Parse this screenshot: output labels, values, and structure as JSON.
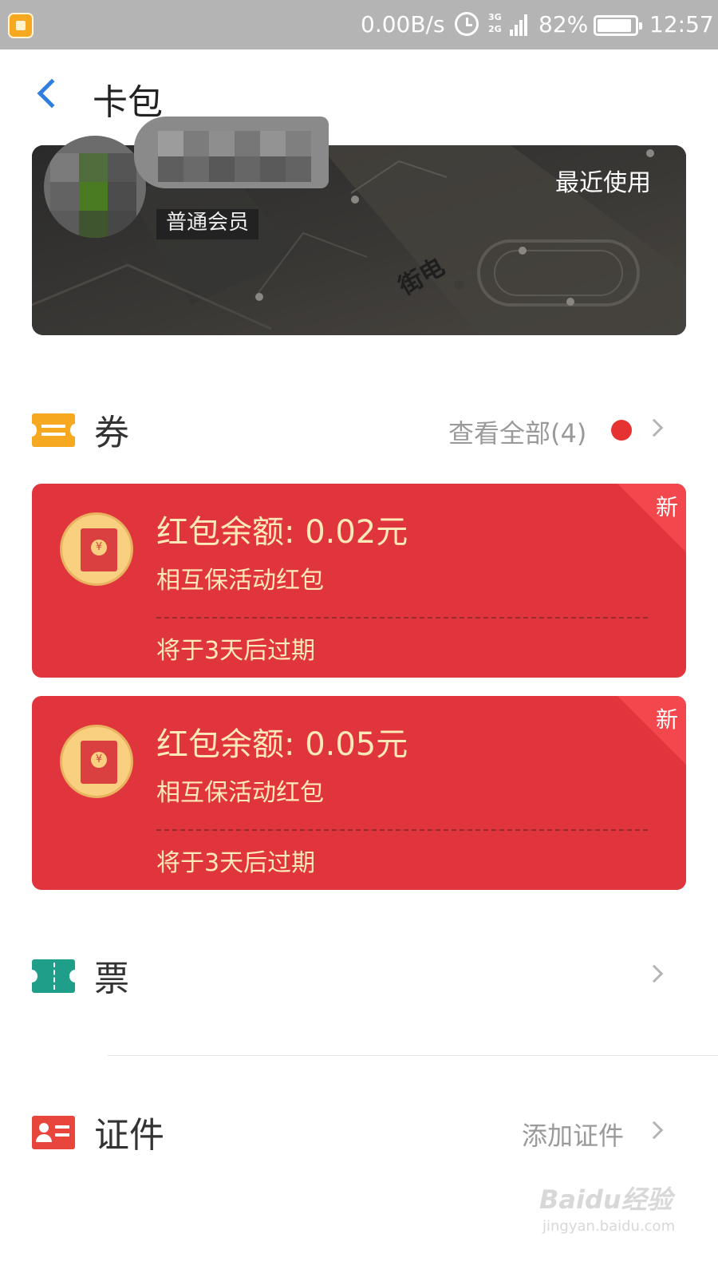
{
  "status_bar": {
    "net_speed": "0.00B/s",
    "network_labels": [
      "3G",
      "2G"
    ],
    "battery": "82%",
    "time": "12:57"
  },
  "header": {
    "title": "卡包",
    "back_icon": "chevron-left-icon"
  },
  "member_card": {
    "recent_label": "最近使用",
    "member_level": "普通会员",
    "avatar": "blurred",
    "name": "blurred"
  },
  "coupons": {
    "title": "券",
    "view_all": "查看全部(4)",
    "has_new_dot": true,
    "items": [
      {
        "amount": "红包余额: 0.02元",
        "description": "相互保活动红包",
        "expire": "将于3天后过期",
        "badge": "新",
        "currency_symbol": "¥"
      },
      {
        "amount": "红包余额: 0.05元",
        "description": "相互保活动红包",
        "expire": "将于3天后过期",
        "badge": "新",
        "currency_symbol": "¥"
      }
    ]
  },
  "tickets": {
    "title": "票"
  },
  "certificates": {
    "title": "证件",
    "action": "添加证件"
  },
  "watermark": {
    "brand": "Baidu经验",
    "url": "jingyan.baidu.com"
  },
  "colors": {
    "accent_blue": "#2f7fe0",
    "coupon_red": "#e0353c",
    "coupon_icon": "#f6a821",
    "ticket_icon": "#1f9e89",
    "certificate_icon": "#e8453c",
    "status_bar": "#b5b4b5"
  }
}
